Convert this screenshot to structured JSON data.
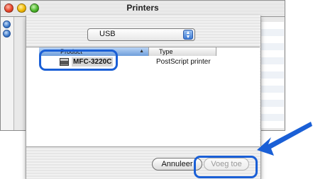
{
  "window": {
    "title": "Printers"
  },
  "dialog": {
    "connection_select": {
      "value": "USB"
    },
    "table": {
      "columns": [
        "Product",
        "Type"
      ],
      "rows": [
        {
          "product": "MFC-3220C",
          "type": "PostScript printer"
        }
      ]
    },
    "buttons": {
      "cancel": "Annuleer",
      "add": "Voeg toe"
    }
  },
  "icons": {
    "close": "close-icon",
    "minimize": "minimize-icon",
    "zoom": "zoom-icon",
    "printer": "printer-icon",
    "arrow": "pointer-arrow-icon"
  },
  "colors": {
    "highlight": "#1a5fd6",
    "selected_column": "#6e9edb"
  }
}
